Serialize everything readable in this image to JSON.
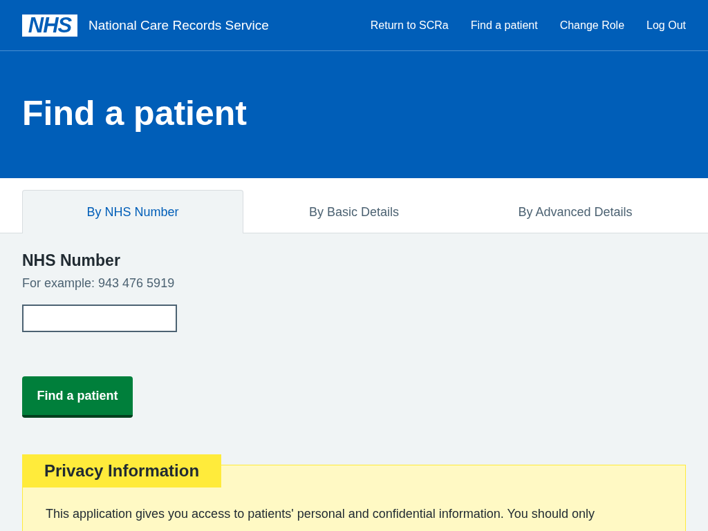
{
  "header": {
    "logo": "NHS",
    "service_name": "National Care Records Service",
    "nav_links": [
      "Return to SCRa",
      "Find a patient",
      "Change Role",
      "Log Out"
    ]
  },
  "page_title": "Find a patient",
  "tabs": [
    {
      "label": "By NHS Number",
      "selected": true
    },
    {
      "label": "By Basic Details",
      "selected": false
    },
    {
      "label": "By Advanced Details",
      "selected": false
    }
  ],
  "form": {
    "field_label": "NHS Number",
    "hint": "For example: 943 476 5919",
    "submit_button": "Find a patient"
  },
  "privacy_panel": {
    "heading": "Privacy Information",
    "text": "This application gives you access to patients' personal and confidential information. You should only"
  }
}
